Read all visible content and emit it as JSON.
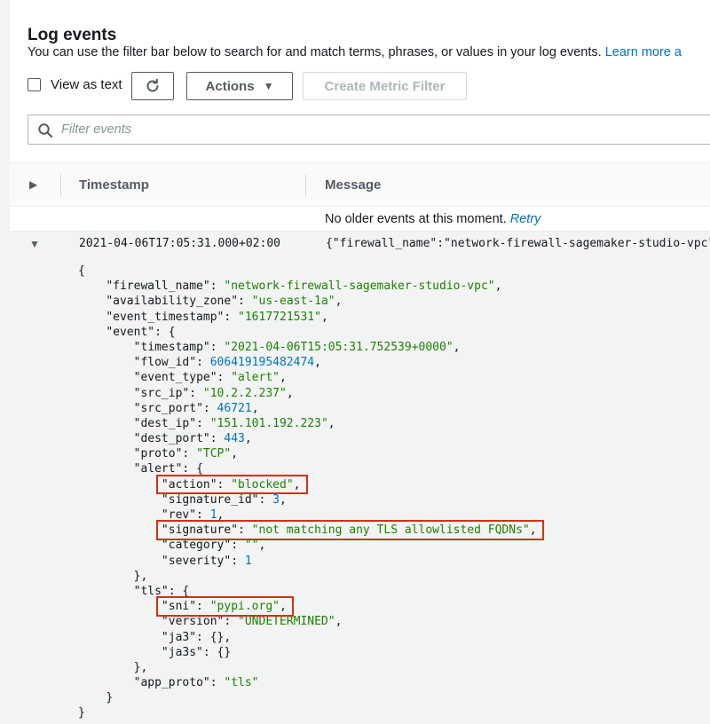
{
  "header": {
    "title": "Log events",
    "subtitle": "You can use the filter bar below to search for and match terms, phrases, or values in your log events.",
    "learn_more": "Learn more a"
  },
  "toolbar": {
    "view_as_text_label": "View as text",
    "view_as_text_checked": false,
    "actions_label": "Actions",
    "create_metric_filter_label": "Create Metric Filter",
    "refresh_icon": "refresh-icon"
  },
  "filter": {
    "placeholder": "Filter events",
    "icon": "search-icon"
  },
  "table": {
    "col_timestamp": "Timestamp",
    "col_message": "Message",
    "no_older_text": "No older events at this moment.",
    "retry_label": "Retry"
  },
  "event_row": {
    "timestamp": "2021-04-06T17:05:31.000+02:00",
    "message": "{\"firewall_name\":\"network-firewall-sagemaker-studio-vpc\","
  },
  "json_lines": [
    {
      "indent": 0,
      "parts": [
        {
          "t": "{",
          "c": "k"
        }
      ]
    },
    {
      "indent": 1,
      "parts": [
        {
          "t": "\"firewall_name\": ",
          "c": "k"
        },
        {
          "t": "\"network-firewall-sagemaker-studio-vpc\"",
          "c": "s"
        },
        {
          "t": ",",
          "c": "k"
        }
      ]
    },
    {
      "indent": 1,
      "parts": [
        {
          "t": "\"availability_zone\": ",
          "c": "k"
        },
        {
          "t": "\"us-east-1a\"",
          "c": "s"
        },
        {
          "t": ",",
          "c": "k"
        }
      ]
    },
    {
      "indent": 1,
      "parts": [
        {
          "t": "\"event_timestamp\": ",
          "c": "k"
        },
        {
          "t": "\"1617721531\"",
          "c": "s"
        },
        {
          "t": ",",
          "c": "k"
        }
      ]
    },
    {
      "indent": 1,
      "parts": [
        {
          "t": "\"event\": {",
          "c": "k"
        }
      ]
    },
    {
      "indent": 2,
      "parts": [
        {
          "t": "\"timestamp\": ",
          "c": "k"
        },
        {
          "t": "\"2021-04-06T15:05:31.752539+0000\"",
          "c": "s"
        },
        {
          "t": ",",
          "c": "k"
        }
      ]
    },
    {
      "indent": 2,
      "parts": [
        {
          "t": "\"flow_id\": ",
          "c": "k"
        },
        {
          "t": "606419195482474",
          "c": "n"
        },
        {
          "t": ",",
          "c": "k"
        }
      ]
    },
    {
      "indent": 2,
      "parts": [
        {
          "t": "\"event_type\": ",
          "c": "k"
        },
        {
          "t": "\"alert\"",
          "c": "s"
        },
        {
          "t": ",",
          "c": "k"
        }
      ]
    },
    {
      "indent": 2,
      "parts": [
        {
          "t": "\"src_ip\": ",
          "c": "k"
        },
        {
          "t": "\"10.2.2.237\"",
          "c": "s"
        },
        {
          "t": ",",
          "c": "k"
        }
      ]
    },
    {
      "indent": 2,
      "parts": [
        {
          "t": "\"src_port\": ",
          "c": "k"
        },
        {
          "t": "46721",
          "c": "n"
        },
        {
          "t": ",",
          "c": "k"
        }
      ]
    },
    {
      "indent": 2,
      "parts": [
        {
          "t": "\"dest_ip\": ",
          "c": "k"
        },
        {
          "t": "\"151.101.192.223\"",
          "c": "s"
        },
        {
          "t": ",",
          "c": "k"
        }
      ]
    },
    {
      "indent": 2,
      "parts": [
        {
          "t": "\"dest_port\": ",
          "c": "k"
        },
        {
          "t": "443",
          "c": "n"
        },
        {
          "t": ",",
          "c": "k"
        }
      ]
    },
    {
      "indent": 2,
      "parts": [
        {
          "t": "\"proto\": ",
          "c": "k"
        },
        {
          "t": "\"TCP\"",
          "c": "s"
        },
        {
          "t": ",",
          "c": "k"
        }
      ]
    },
    {
      "indent": 2,
      "parts": [
        {
          "t": "\"alert\": {",
          "c": "k"
        }
      ]
    },
    {
      "indent": 3,
      "parts": [
        {
          "t": "\"action\": ",
          "c": "k"
        },
        {
          "t": "\"blocked\"",
          "c": "s"
        },
        {
          "t": ",",
          "c": "k"
        }
      ]
    },
    {
      "indent": 3,
      "parts": [
        {
          "t": "\"signature_id\": ",
          "c": "k"
        },
        {
          "t": "3",
          "c": "n"
        },
        {
          "t": ",",
          "c": "k"
        }
      ]
    },
    {
      "indent": 3,
      "parts": [
        {
          "t": "\"rev\": ",
          "c": "k"
        },
        {
          "t": "1",
          "c": "n"
        },
        {
          "t": ",",
          "c": "k"
        }
      ]
    },
    {
      "indent": 3,
      "parts": [
        {
          "t": "\"signature\": ",
          "c": "k"
        },
        {
          "t": "\"not matching any TLS allowlisted FQDNs\"",
          "c": "s"
        },
        {
          "t": ",",
          "c": "k"
        }
      ]
    },
    {
      "indent": 3,
      "parts": [
        {
          "t": "\"category\": ",
          "c": "k"
        },
        {
          "t": "\"\"",
          "c": "s"
        },
        {
          "t": ",",
          "c": "k"
        }
      ]
    },
    {
      "indent": 3,
      "parts": [
        {
          "t": "\"severity\": ",
          "c": "k"
        },
        {
          "t": "1",
          "c": "n"
        }
      ]
    },
    {
      "indent": 2,
      "parts": [
        {
          "t": "},",
          "c": "k"
        }
      ]
    },
    {
      "indent": 2,
      "parts": [
        {
          "t": "\"tls\": {",
          "c": "k"
        }
      ]
    },
    {
      "indent": 3,
      "parts": [
        {
          "t": "\"sni\": ",
          "c": "k"
        },
        {
          "t": "\"pypi.org\"",
          "c": "s"
        },
        {
          "t": ",",
          "c": "k"
        }
      ]
    },
    {
      "indent": 3,
      "parts": [
        {
          "t": "\"version\": ",
          "c": "k"
        },
        {
          "t": "\"UNDETERMINED\"",
          "c": "s"
        },
        {
          "t": ",",
          "c": "k"
        }
      ]
    },
    {
      "indent": 3,
      "parts": [
        {
          "t": "\"ja3\": {},",
          "c": "k"
        }
      ]
    },
    {
      "indent": 3,
      "parts": [
        {
          "t": "\"ja3s\": {}",
          "c": "k"
        }
      ]
    },
    {
      "indent": 2,
      "parts": [
        {
          "t": "},",
          "c": "k"
        }
      ]
    },
    {
      "indent": 2,
      "parts": [
        {
          "t": "\"app_proto\": ",
          "c": "k"
        },
        {
          "t": "\"tls\"",
          "c": "s"
        }
      ]
    },
    {
      "indent": 1,
      "parts": [
        {
          "t": "}",
          "c": "k"
        }
      ]
    },
    {
      "indent": 0,
      "parts": [
        {
          "t": "}",
          "c": "k"
        }
      ]
    }
  ],
  "highlight_color": "#d13212",
  "highlighted_lines": [
    14,
    17,
    22
  ]
}
